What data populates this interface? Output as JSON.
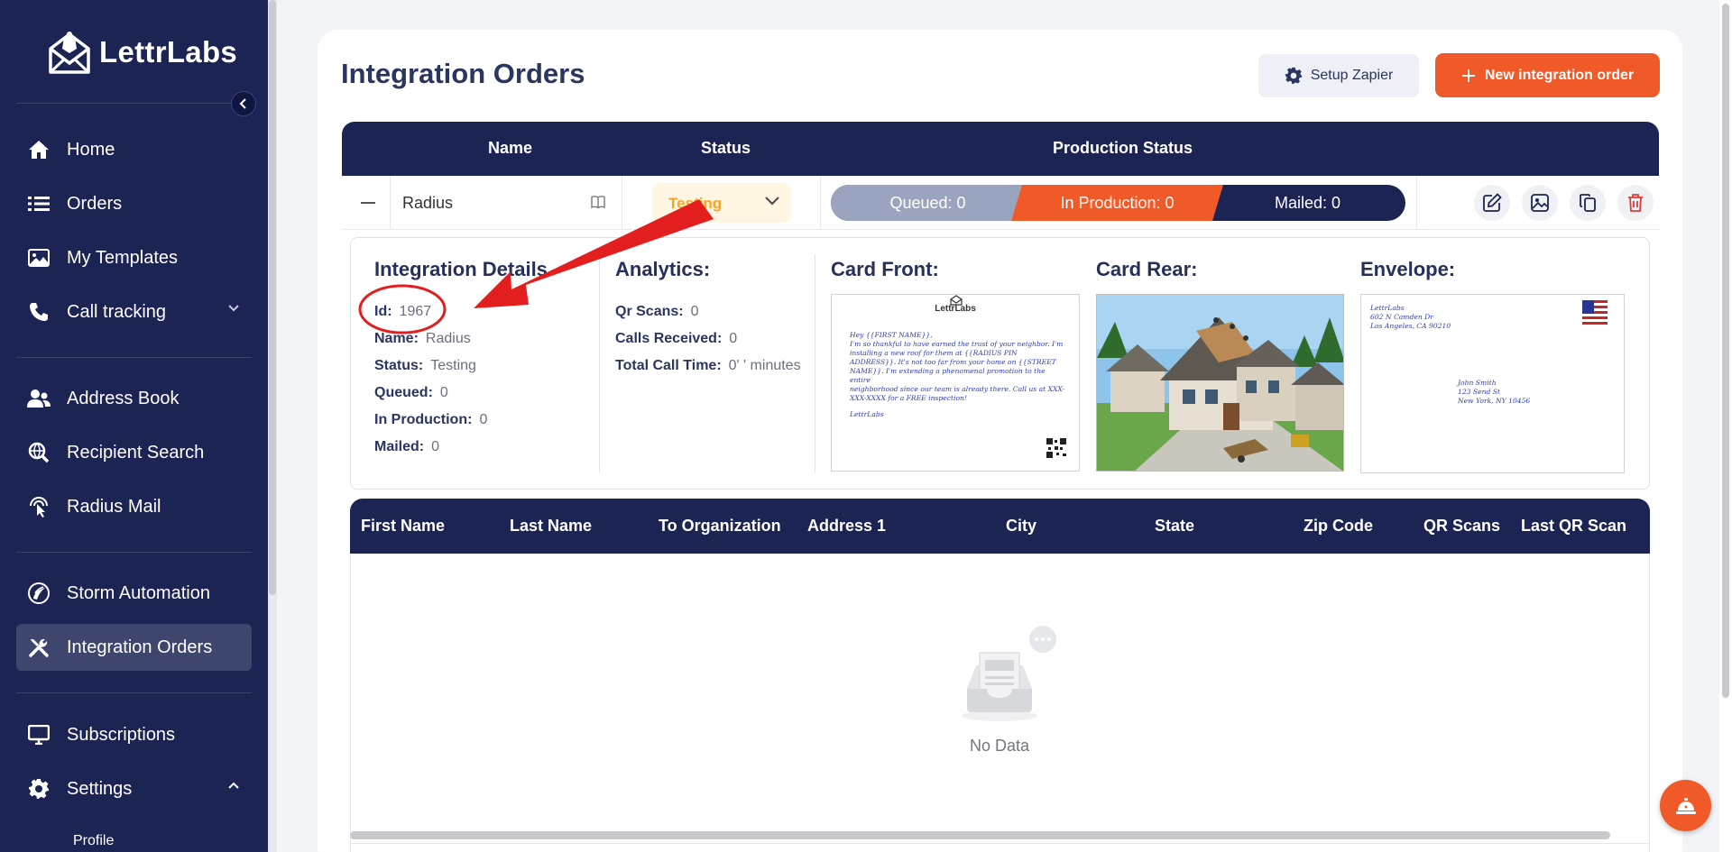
{
  "app": {
    "name": "LettrLabs"
  },
  "sidebar": {
    "items": [
      {
        "label": "Home",
        "icon": "home-icon"
      },
      {
        "label": "Orders",
        "icon": "list-icon"
      },
      {
        "label": "My Templates",
        "icon": "image-icon"
      },
      {
        "label": "Call tracking",
        "icon": "phone-icon"
      },
      {
        "label": "Address Book",
        "icon": "users-icon"
      },
      {
        "label": "Recipient Search",
        "icon": "search-globe-icon"
      },
      {
        "label": "Radius Mail",
        "icon": "radius-pointer-icon"
      },
      {
        "label": "Storm Automation",
        "icon": "storm-icon"
      },
      {
        "label": "Integration Orders",
        "icon": "tools-icon",
        "active": true
      },
      {
        "label": "Subscriptions",
        "icon": "monitor-icon"
      },
      {
        "label": "Settings",
        "icon": "gear-icon"
      }
    ],
    "sub_items": [
      {
        "label": "Profile"
      }
    ]
  },
  "page": {
    "title": "Integration Orders",
    "setup_zapier_label": "Setup Zapier",
    "new_order_label": "New integration order"
  },
  "orders_table": {
    "headers": {
      "name": "Name",
      "status": "Status",
      "production_status": "Production Status"
    },
    "row": {
      "name": "Radius",
      "status": "Testing",
      "queued_label": "Queued:",
      "queued": "0",
      "in_production_label": "In Production:",
      "in_production": "0",
      "mailed_label": "Mailed:",
      "mailed": "0"
    }
  },
  "details": {
    "integration": {
      "heading": "Integration Details",
      "id_label": "Id:",
      "id": "1967",
      "name_label": "Name:",
      "name": "Radius",
      "status_label": "Status:",
      "status": "Testing",
      "queued_label": "Queued:",
      "queued": "0",
      "in_production_label": "In Production:",
      "in_production": "0",
      "mailed_label": "Mailed:",
      "mailed": "0"
    },
    "analytics": {
      "heading": "Analytics:",
      "qr_scans_label": "Qr Scans:",
      "qr_scans": "0",
      "calls_received_label": "Calls Received:",
      "calls_received": "0",
      "total_call_time_label": "Total Call Time:",
      "total_call_time": "0' ' minutes"
    },
    "card_front": {
      "heading": "Card Front:",
      "brand": "LettrLabs",
      "lines": [
        "Hey {{FIRST NAME}},",
        "I'm so thankful to have earned the trust of your neighbor. I'm",
        "installing a new roof for them at {{RADIUS PIN",
        "ADDRESS}}. It's not too far from your home on {{STREET",
        "NAME}}. I'm extending a phenomenal promotion to the entire",
        "neighborhood since our team is already there. Call us at XXX-",
        "XXX-XXXX for a FREE inspection!"
      ],
      "signature": "LettrLabs"
    },
    "card_rear": {
      "heading": "Card Rear:"
    },
    "envelope": {
      "heading": "Envelope:",
      "return_lines": [
        "LettrLabs",
        "602 N Camden Dr",
        "Los Angeles, CA 90210"
      ],
      "to_lines": [
        "John Smith",
        "123 Send St",
        "New York, NY 10456"
      ]
    }
  },
  "recipients_table": {
    "headers": [
      "First Name",
      "Last Name",
      "To Organization",
      "Address 1",
      "City",
      "State",
      "Zip Code",
      "QR Scans",
      "Last QR Scan"
    ],
    "empty_text": "No Data"
  },
  "colors": {
    "sidebar_bg": "#1c2453",
    "accent": "#f05a28",
    "status_testing": "#f5a623",
    "annotation": "#e31e1e"
  }
}
